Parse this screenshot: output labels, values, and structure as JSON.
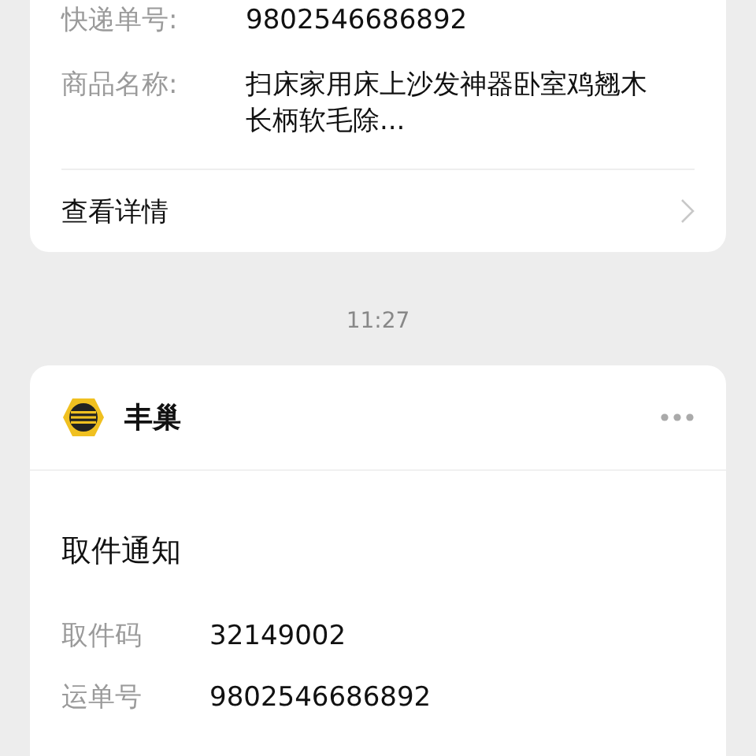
{
  "order_card": {
    "rows": [
      {
        "label": "快递单号:",
        "value": "9802546686892"
      },
      {
        "label": "商品名称:",
        "value": "扫床家用床上沙发神器卧室鸡翘木长柄软毛除..."
      }
    ],
    "details_link": "查看详情"
  },
  "timestamp": "11:27",
  "notice_card": {
    "sender": "丰巢",
    "title": "取件通知",
    "rows": [
      {
        "label": "取件码",
        "value": "32149002"
      },
      {
        "label": "运单号",
        "value": "9802546686892"
      }
    ]
  }
}
